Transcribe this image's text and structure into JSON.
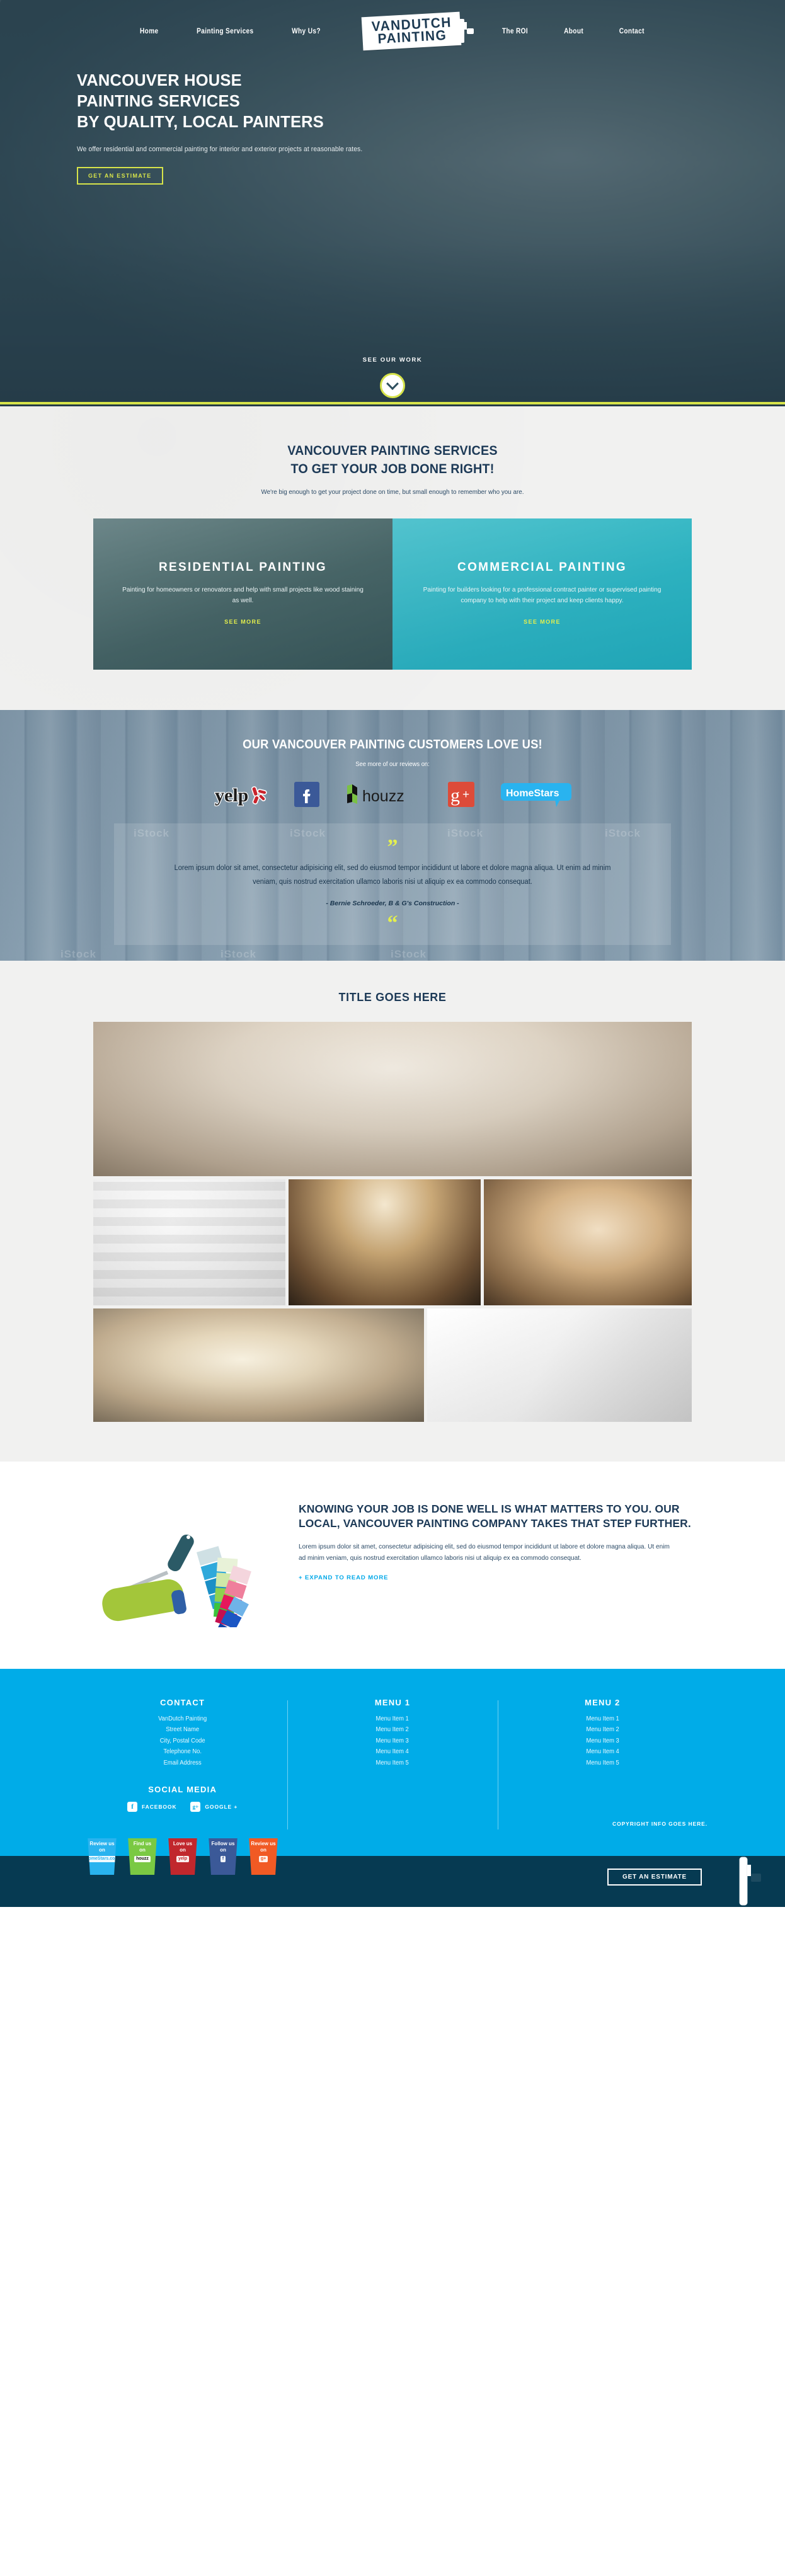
{
  "nav": {
    "left_items": [
      {
        "label": "Home"
      },
      {
        "label": "Painting Services"
      },
      {
        "label": "Why Us?"
      }
    ],
    "right_items": [
      {
        "label": "The ROI"
      },
      {
        "label": "About"
      },
      {
        "label": "Contact"
      }
    ],
    "logo_line1": "VANDUTCH",
    "logo_line2": "PAINTING",
    "logo_icon": "paint-roller-icon"
  },
  "hero": {
    "headline_line1": "VANCOUVER HOUSE",
    "headline_line2": "PAINTING SERVICES",
    "headline_line3": "BY QUALITY, LOCAL PAINTERS",
    "subtext": "We offer residential and commercial painting for interior and exterior projects at reasonable rates.",
    "cta_label": "GET AN ESTIMATE",
    "scroll_label": "SEE OUR WORK",
    "scroll_icon": "chevron-down-icon",
    "accent_color": "#d6e34a"
  },
  "services": {
    "title_line1": "VANCOUVER PAINTING SERVICES",
    "title_line2": "TO GET YOUR JOB DONE RIGHT!",
    "subtitle": "We're big enough to get your project done on time, but small enough to remember who you are.",
    "cards": [
      {
        "title": "RESIDENTIAL PAINTING",
        "text": "Painting for homeowners or renovators and help with small projects like wood staining as well.",
        "link_label": "SEE MORE"
      },
      {
        "title": "COMMERCIAL PAINTING",
        "text": "Painting for builders looking for a professional contract painter or supervised painting company to help with their project and keep clients happy.",
        "link_label": "SEE MORE"
      }
    ]
  },
  "reviews": {
    "title": "OUR VANCOUVER PAINTING CUSTOMERS LOVE US!",
    "subtitle": "See more of our reviews on:",
    "logos": [
      {
        "name": "yelp-logo",
        "label": "yelp"
      },
      {
        "name": "facebook-logo",
        "label": "f"
      },
      {
        "name": "houzz-logo",
        "label": "houzz"
      },
      {
        "name": "google-plus-logo",
        "label": "g+"
      },
      {
        "name": "homestars-logo",
        "label": "HomeStars"
      }
    ],
    "quote_open": "”",
    "quote_close": "“",
    "quote_text": "Lorem ipsum dolor sit amet, consectetur adipisicing elit, sed do eiusmod tempor incididunt ut labore et dolore magna aliqua. Ut enim ad minim veniam, quis nostrud exercitation ullamco laboris nisi ut aliquip ex ea commodo consequat.",
    "quote_author": "- Bernie Schroeder, B & G's Construction -",
    "watermark": "iStock"
  },
  "gallery": {
    "title": "TITLE GOES HERE",
    "images": [
      {
        "name": "gallery-living-room"
      },
      {
        "name": "gallery-ceiling-detail"
      },
      {
        "name": "gallery-kitchen"
      },
      {
        "name": "gallery-dining-room"
      },
      {
        "name": "gallery-spiral-staircase"
      },
      {
        "name": "gallery-crown-molding"
      }
    ]
  },
  "roi": {
    "image_name": "paint-roller-and-swatches",
    "heading": "KNOWING YOUR JOB IS DONE WELL IS WHAT MATTERS TO YOU. OUR LOCAL, VANCOUVER PAINTING COMPANY TAKES THAT STEP FURTHER.",
    "paragraph": "Lorem ipsum dolor sit amet, consectetur adipisicing elit, sed do eiusmod tempor incididunt ut labore et dolore magna aliqua. Ut enim ad minim veniam, quis nostrud exercitation ullamco laboris nisi ut aliquip ex ea commodo consequat.",
    "expand_label": "+ EXPAND TO READ MORE",
    "link_color": "#00a8e8"
  },
  "footer": {
    "background_color": "#00ace8",
    "contact": {
      "heading": "CONTACT",
      "lines": [
        "VanDutch Painting",
        "Street Name",
        "City, Postal Code",
        "Telephone No.",
        "Email Address"
      ]
    },
    "social": {
      "heading": "SOCIAL MEDIA",
      "items": [
        {
          "icon": "facebook-icon",
          "glyph": "f",
          "label": "FACEBOOK"
        },
        {
          "icon": "google-plus-icon",
          "glyph": "g+",
          "label": "GOOGLE +"
        }
      ]
    },
    "menu1": {
      "heading": "MENU 1",
      "items": [
        "Menu Item 1",
        "Menu Item 2",
        "Menu Item 3",
        "Menu Item 4",
        "Menu Item 5"
      ]
    },
    "menu2": {
      "heading": "MENU 2",
      "items": [
        "Menu Item 1",
        "Menu Item 2",
        "Menu Item 3",
        "Menu Item 4",
        "Menu Item 5"
      ]
    },
    "copyright": "COPYRIGHT INFO GOES HERE."
  },
  "bottombar": {
    "background_color": "#063a52",
    "cta_label": "GET AN ESTIMATE",
    "roller_icon": "paint-roller-icon",
    "buckets": [
      {
        "line1": "Review us",
        "line2": "on",
        "tag": "HomeStars.com",
        "color": "#29b3ef"
      },
      {
        "line1": "Find us",
        "line2": "on",
        "tag": "houzz",
        "color": "#7ac943"
      },
      {
        "line1": "Love us",
        "line2": "on",
        "tag": "yelp",
        "color": "#c1272d"
      },
      {
        "line1": "Follow us",
        "line2": "on",
        "tag": "f",
        "color": "#3b5998"
      },
      {
        "line1": "Review us",
        "line2": "on",
        "tag": "g+",
        "color": "#f15a24"
      }
    ]
  }
}
